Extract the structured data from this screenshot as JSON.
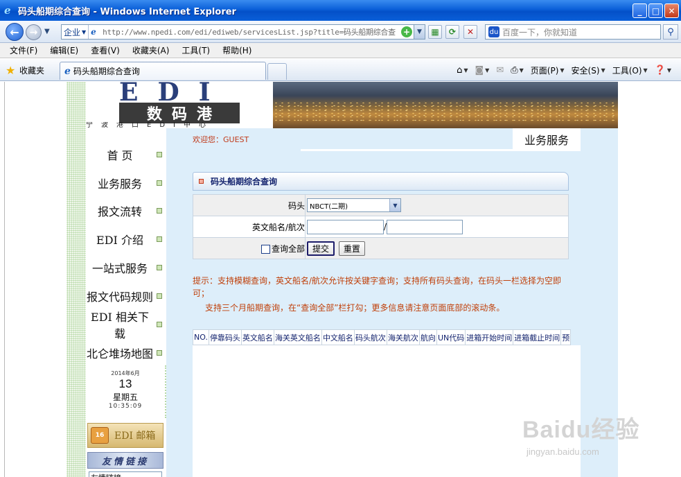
{
  "window": {
    "title": "码头船期综合查询 - Windows Internet Explorer",
    "minimize": "_",
    "maximize": "□",
    "close": "✕"
  },
  "address": {
    "zone": "企业",
    "url": "http://www.npedi.com/edi/ediweb/servicesList.jsp?title=码头船期综合查",
    "search_placeholder": "百度一下，你就知道"
  },
  "menu": [
    "文件(F)",
    "编辑(E)",
    "查看(V)",
    "收藏夹(A)",
    "工具(T)",
    "帮助(H)"
  ],
  "favorites": {
    "label": "收藏夹",
    "tab_title": "码头船期综合查询"
  },
  "commands": {
    "page": "页面(P)",
    "safety": "安全(S)",
    "tools": "工具(O)"
  },
  "banner": {
    "logo_letters": [
      "E",
      "D",
      "I"
    ],
    "logo_name": [
      "数",
      "码",
      "港"
    ],
    "logo_sub": "宁波港口EDI中心"
  },
  "sidebar": {
    "items": [
      "首 页",
      "业务服务",
      "报文流转",
      "EDI 介绍",
      "一站式服务",
      "报文代码规则",
      "EDI 相关下载",
      "北仑堆场地图"
    ],
    "clock": {
      "year_month": "2014年6月",
      "day": "13",
      "weekday": "星期五",
      "time": "10:35:09"
    },
    "mail_label": "EDI 邮箱",
    "mail_badge": "16",
    "friend_label": "友情链接",
    "friend_select": "友情链接"
  },
  "main": {
    "welcome": "欢迎您：GUEST",
    "section_tab": "业务服务",
    "panel_title": "码头船期综合查询",
    "form": {
      "terminal_label": "码头",
      "terminal_value": "NBCT(二期)",
      "vessel_label": "英文船名/航次",
      "vessel_separator": "/",
      "query_all_label": "查询全部",
      "submit": "提交",
      "reset": "重置"
    },
    "hint_line1": "提示：支持模糊查询，英文船名/航次允许按关键字查询；支持所有码头查询，在码头一栏选择为空即可；",
    "hint_line2": "支持三个月船期查询，在“查询全部”栏打勾；更多信息请注意页面底部的滚动条。",
    "columns": [
      "NO.",
      "停靠码头",
      "英文船名",
      "海关英文船名",
      "中文船名",
      "码头航次",
      "海关航次",
      "航向",
      "UN代码",
      "进箱开始时间",
      "进箱截止时间",
      "预"
    ]
  },
  "watermark": {
    "logo": "Baidu经验",
    "sub": "jingyan.baidu.com"
  }
}
